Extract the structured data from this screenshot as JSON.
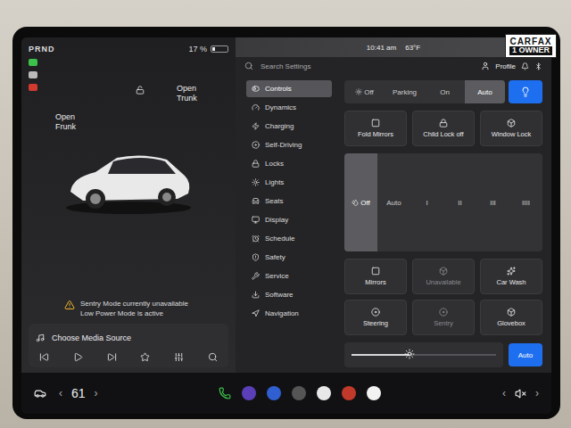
{
  "status": {
    "gear": "PRND",
    "battery": "17 %",
    "battery_level": 0.17
  },
  "car": {
    "frunk": "Open Frunk",
    "trunk": "Open Trunk"
  },
  "alert": {
    "title": "Sentry Mode currently unavailable",
    "detail": "Low Power Mode is active"
  },
  "media": {
    "placeholder": "Choose Media Source"
  },
  "top_bar": {
    "time": "10:41 am",
    "temperature": "63°F",
    "search": "Search Settings",
    "profile": "Profile"
  },
  "sidebar": {
    "items": [
      {
        "label": "Controls",
        "selected": true
      },
      {
        "label": "Dynamics",
        "selected": false
      },
      {
        "label": "Charging",
        "selected": false
      },
      {
        "label": "Self-Driving",
        "selected": false
      },
      {
        "label": "Locks",
        "selected": false
      },
      {
        "label": "Lights",
        "selected": false
      },
      {
        "label": "Seats",
        "selected": false
      },
      {
        "label": "Display",
        "selected": false
      },
      {
        "label": "Schedule",
        "selected": false
      },
      {
        "label": "Safety",
        "selected": false
      },
      {
        "label": "Service",
        "selected": false
      },
      {
        "label": "Software",
        "selected": false
      },
      {
        "label": "Navigation",
        "selected": false
      }
    ]
  },
  "headlights": [
    {
      "label": "Off",
      "selected": false
    },
    {
      "label": "Parking",
      "selected": false
    },
    {
      "label": "On",
      "selected": false
    },
    {
      "label": "Auto",
      "selected": true
    }
  ],
  "quick": [
    {
      "label": "Fold Mirrors"
    },
    {
      "label": "Child Lock off"
    },
    {
      "label": "Window Lock"
    }
  ],
  "wipers": [
    {
      "label": "Off",
      "selected": true
    },
    {
      "label": "Auto",
      "selected": false
    },
    {
      "label": "I",
      "selected": false
    },
    {
      "label": "II",
      "selected": false
    },
    {
      "label": "III",
      "selected": false
    },
    {
      "label": "IIII",
      "selected": false
    }
  ],
  "tiles": [
    {
      "label": "Mirrors",
      "disabled": false
    },
    {
      "label": "Unavailable",
      "disabled": true
    },
    {
      "label": "Car Wash",
      "disabled": false
    },
    {
      "label": "Steering",
      "disabled": false
    },
    {
      "label": "Sentry",
      "disabled": true
    },
    {
      "label": "Glovebox",
      "disabled": false
    }
  ],
  "brightness": {
    "level": 0.4,
    "auto": "Auto",
    "auto_on": true
  },
  "bottom_bar": {
    "temperature": "61",
    "left": "‹",
    "right": "›"
  },
  "volume": {
    "muted": true,
    "left": "‹",
    "right": "›"
  },
  "badge": {
    "brand": "CARFAX",
    "owners": "1 OWNER"
  }
}
